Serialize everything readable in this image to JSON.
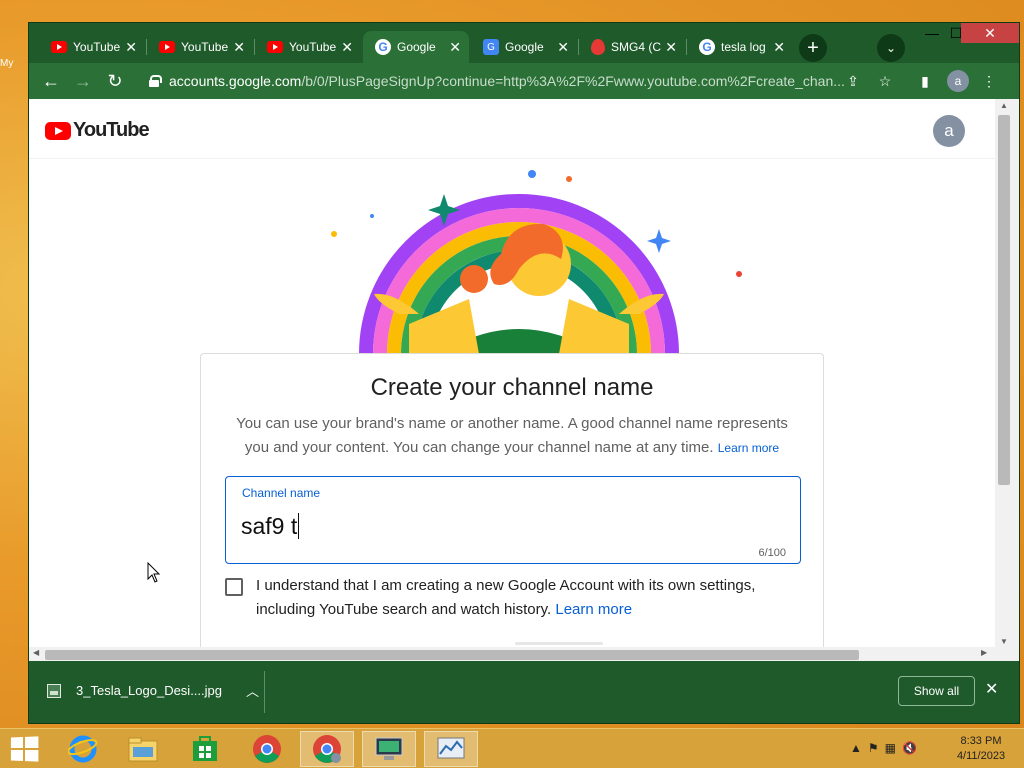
{
  "desktop": {
    "icon_label_partial": "My"
  },
  "browser": {
    "tabs": [
      {
        "title": "YouTube",
        "favicon": "youtube-icon",
        "active": false
      },
      {
        "title": "YouTube",
        "favicon": "youtube-icon",
        "active": false
      },
      {
        "title": "YouTube",
        "favicon": "youtube-icon",
        "active": false
      },
      {
        "title": "Google",
        "favicon": "google-icon",
        "active": true
      },
      {
        "title": "Google",
        "favicon": "google-translate-icon",
        "active": false
      },
      {
        "title": "SMG4 (C",
        "favicon": "smg4-icon",
        "active": false
      },
      {
        "title": "tesla log",
        "favicon": "google-icon",
        "active": false
      }
    ],
    "new_tab_symbol": "+",
    "url_host": "accounts.google.com",
    "url_path": "/b/0/PlusPageSignUp?continue=http%3A%2F%2Fwww.youtube.com%2Fcreate_chan...",
    "profile_initial": "a"
  },
  "page": {
    "logo_text": "YouTube",
    "avatar_initial": "a",
    "title": "Create your channel name",
    "description": "You can use your brand's name or another name. A good channel name represents you and your content. You can change your channel name at any time.",
    "description_learn_more": "Learn more",
    "field_label": "Channel name",
    "field_value": "saf9 t",
    "char_counter": "6/100",
    "checkbox_text": "I understand that I am creating a new Google Account with its own settings, including YouTube search and watch history.",
    "checkbox_learn_more": "Learn more",
    "checkbox_checked": false
  },
  "downloads": {
    "file_name": "3_Tesla_Logo_Desi....jpg",
    "show_all_label": "Show all"
  },
  "taskbar": {
    "apps": [
      "internet-explorer-icon",
      "file-explorer-icon",
      "store-icon",
      "chrome-icon",
      "chrome-profile-icon",
      "remote-desktop-icon",
      "network-monitor-icon"
    ],
    "time": "8:33 PM",
    "date": "4/11/2023"
  },
  "colors": {
    "accent_blue": "#065fd4",
    "youtube_red": "#ff0000",
    "browser_frame": "#1f5a2b",
    "desktop": "#e89a2a"
  }
}
